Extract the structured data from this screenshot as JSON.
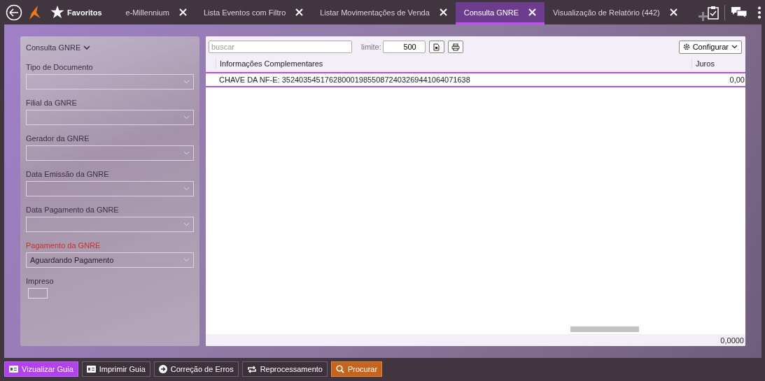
{
  "favorites": "Favoritos",
  "tabs": [
    {
      "label": "e-Millennium",
      "selected": false
    },
    {
      "label": "Lista Eventos com Filtro",
      "selected": false
    },
    {
      "label": "Listar Movimentações de Venda",
      "selected": false
    },
    {
      "label": "Consulta GNRE",
      "selected": true
    },
    {
      "label": "Visualização de Relatório (442)",
      "selected": false
    }
  ],
  "filter": {
    "title": "Consulta GNRE",
    "fields": [
      {
        "kind": "select",
        "label": "Tipo de Documento",
        "required": false
      },
      {
        "kind": "select",
        "label": "Filial da GNRE",
        "required": false
      },
      {
        "kind": "select",
        "label": "Gerador da GNRE",
        "required": false
      },
      {
        "kind": "select",
        "label": "Data Emissão da GNRE",
        "required": false
      },
      {
        "kind": "select",
        "label": "Data Pagamento da GNRE",
        "required": false
      },
      {
        "kind": "select",
        "label": "Pagamento da GNRE",
        "required": true,
        "value": "Aguardando Pagamento"
      },
      {
        "kind": "checkbox",
        "label": "Impreso",
        "required": false,
        "checked": false
      }
    ]
  },
  "grid": {
    "search_placeholder": "buscar",
    "limit_label": "limite:",
    "limit": "500",
    "configure": "Configurar",
    "columns": [
      "Informações Complementares",
      "Juros"
    ],
    "rows": [
      {
        "cells": [
          "CHAVE DA NF-E: 35240354517628000198550872403269441064071638",
          "0,00"
        ],
        "selected": true
      }
    ],
    "total": "0,0000"
  },
  "actions": [
    {
      "label": "Vizualizar Guia",
      "kind": "primary"
    },
    {
      "label": "Imprimir Guia",
      "kind": "default"
    },
    {
      "label": "Correção de Erros",
      "kind": "default"
    },
    {
      "label": "Reprocessamento",
      "kind": "default"
    },
    {
      "label": "Procurar",
      "kind": "search"
    }
  ]
}
